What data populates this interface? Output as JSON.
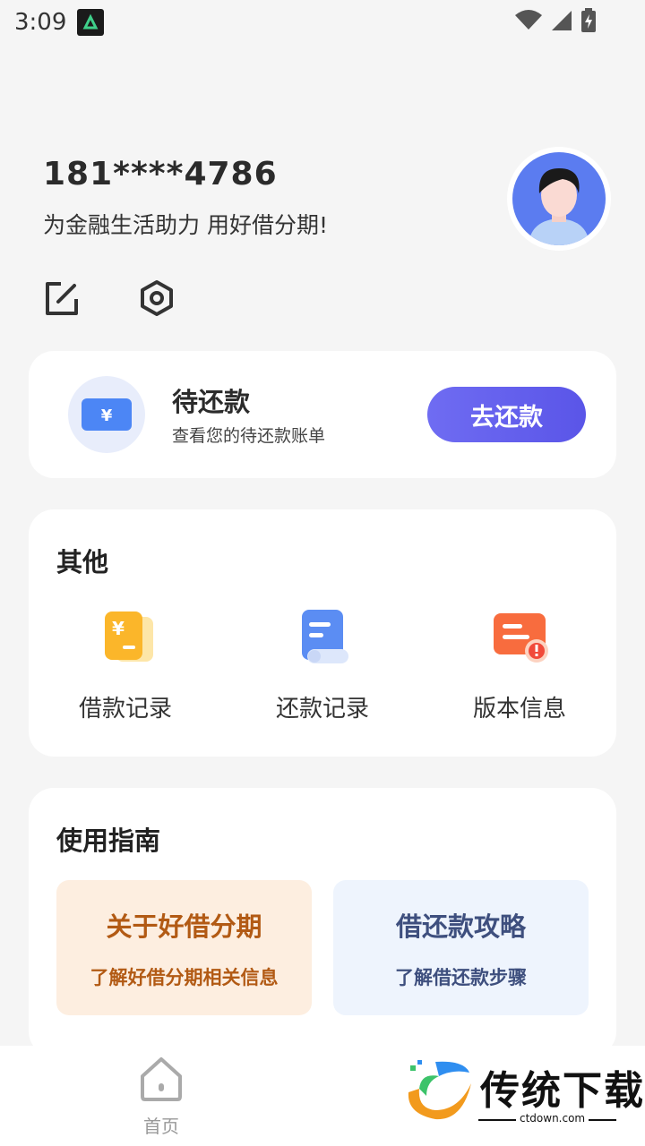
{
  "status_bar": {
    "time": "3:09",
    "icons": [
      "app-notification-icon",
      "wifi-icon",
      "cellular-signal-icon",
      "battery-charging-icon"
    ]
  },
  "profile": {
    "phone": "181****4786",
    "slogan": "为金融生活助力 用好借分期!",
    "actions": [
      "edit-icon",
      "settings-icon"
    ]
  },
  "repay": {
    "title": "待还款",
    "subtitle": "查看您的待还款账单",
    "button": "去还款",
    "icon": "yuan-card-icon"
  },
  "other": {
    "title": "其他",
    "items": [
      {
        "label": "借款记录",
        "icon": "loan-record-icon"
      },
      {
        "label": "还款记录",
        "icon": "repayment-record-icon"
      },
      {
        "label": "版本信息",
        "icon": "version-info-icon"
      }
    ]
  },
  "guide": {
    "title": "使用指南",
    "tiles": [
      {
        "title": "关于好借分期",
        "subtitle": "了解好借分期相关信息"
      },
      {
        "title": "借还款攻略",
        "subtitle": "了解借还款步骤"
      }
    ]
  },
  "tabbar": {
    "home_label": "首页"
  },
  "watermark": {
    "text": "传统下载",
    "url": "ctdown.com"
  },
  "colors": {
    "accent": "#5a55e8",
    "about_tile_text": "#b25a14",
    "guide_tile_text": "#3e4f7e"
  }
}
